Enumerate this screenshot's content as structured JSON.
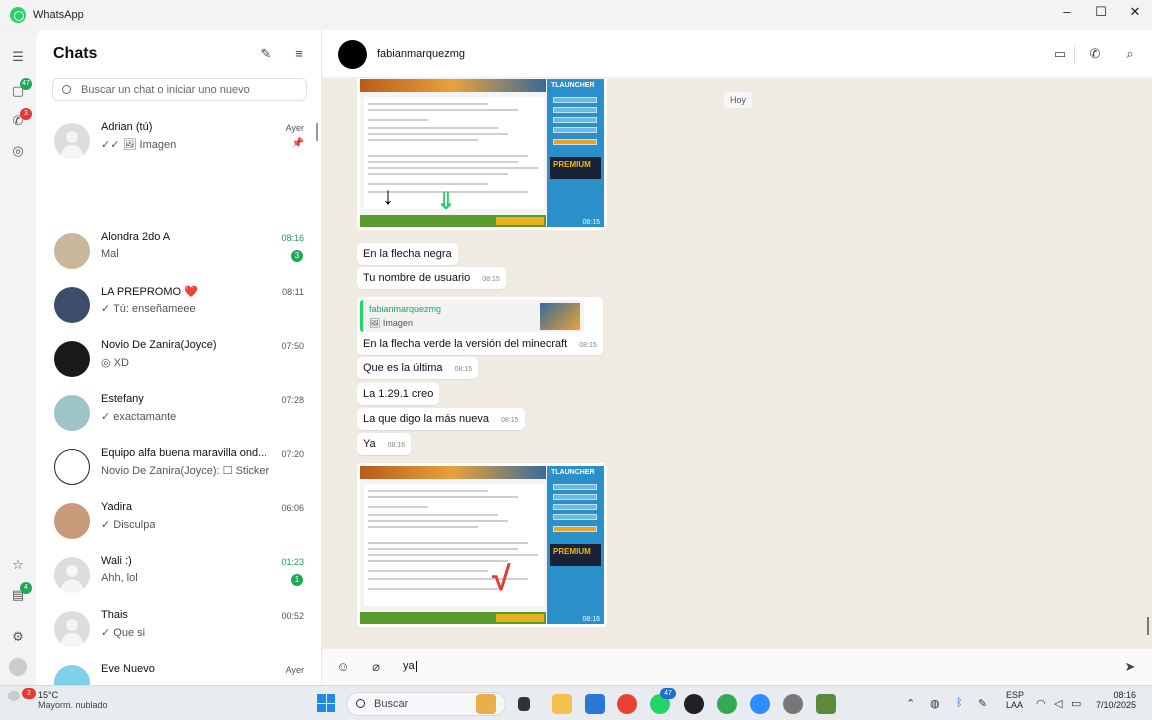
{
  "window": {
    "title": "WhatsApp",
    "minimize": "–",
    "maximize": "☐",
    "close": "✕"
  },
  "rail": {
    "chats_badge": "47",
    "status_badge": "3",
    "archive_badge": "4"
  },
  "sidebar": {
    "title": "Chats",
    "search_placeholder": "Buscar un chat o iniciar uno nuevo",
    "chats": [
      {
        "name": "Adrian (tú)",
        "msg": "✓✓ 🖼 Imagen",
        "time": "Ayer",
        "pinned": true
      },
      {
        "name": "Alondra 2do A",
        "msg": "Mal",
        "time": "08:16",
        "unread": "3"
      },
      {
        "name": "LA PREPROMO ❤️",
        "msg": "✓ Tú: enseñameee",
        "time": "08:11"
      },
      {
        "name": "Novio De Zanira(Joyce)",
        "msg": "◎ XD",
        "time": "07:50"
      },
      {
        "name": "Estefany",
        "msg": "✓ exactamante",
        "time": "07:28"
      },
      {
        "name": "Equipo alfa buena maravilla ond...",
        "msg": "Novio De Zanira(Joyce): ☐ Sticker",
        "time": "07:20"
      },
      {
        "name": "Yadira",
        "msg": "✓ Disculpa",
        "time": "06:06"
      },
      {
        "name": "Wali :)",
        "msg": "Ahh, lol",
        "time": "01:23",
        "unread": "1"
      },
      {
        "name": "Thais",
        "msg": "✓ Que si",
        "time": "00:52"
      },
      {
        "name": "Eve Nuevo",
        "msg": "",
        "time": "Ayer"
      }
    ]
  },
  "header": {
    "contact": "fabianmarquezmg"
  },
  "conversation": {
    "day": "Hoy",
    "messages": [
      {
        "text": "En la flecha negra",
        "time": ""
      },
      {
        "text": "Tu nombre de usuario",
        "time": "08:15"
      },
      {
        "quote_name": "fabianmarquezmg",
        "quote_text": "🖼 Imagen",
        "text": "En la flecha verde la versión del minecraft",
        "time": "08:15"
      },
      {
        "text": "Que es la última",
        "time": "08:15"
      },
      {
        "text": "La 1.29.1 creo",
        "time": ""
      },
      {
        "text": "La que digo la más nueva",
        "time": "08:15"
      },
      {
        "text": "Ya",
        "time": "08:16"
      }
    ],
    "images": [
      {
        "brand": "TLAUNCHER",
        "premium": "PREMIUM",
        "time": "08:15"
      },
      {
        "brand": "TLAUNCHER",
        "premium": "PREMIUM",
        "time": "08:16"
      }
    ]
  },
  "composer": {
    "value": "ya"
  },
  "taskbar": {
    "weather_temp": "15°C",
    "weather_desc": "Mayorm. nublado",
    "weather_badge": "2",
    "search": "Buscar",
    "whatsapp_badge": "47",
    "lang": "ESP",
    "lang2": "LAA",
    "time": "08:16",
    "date": "7/10/2025"
  }
}
